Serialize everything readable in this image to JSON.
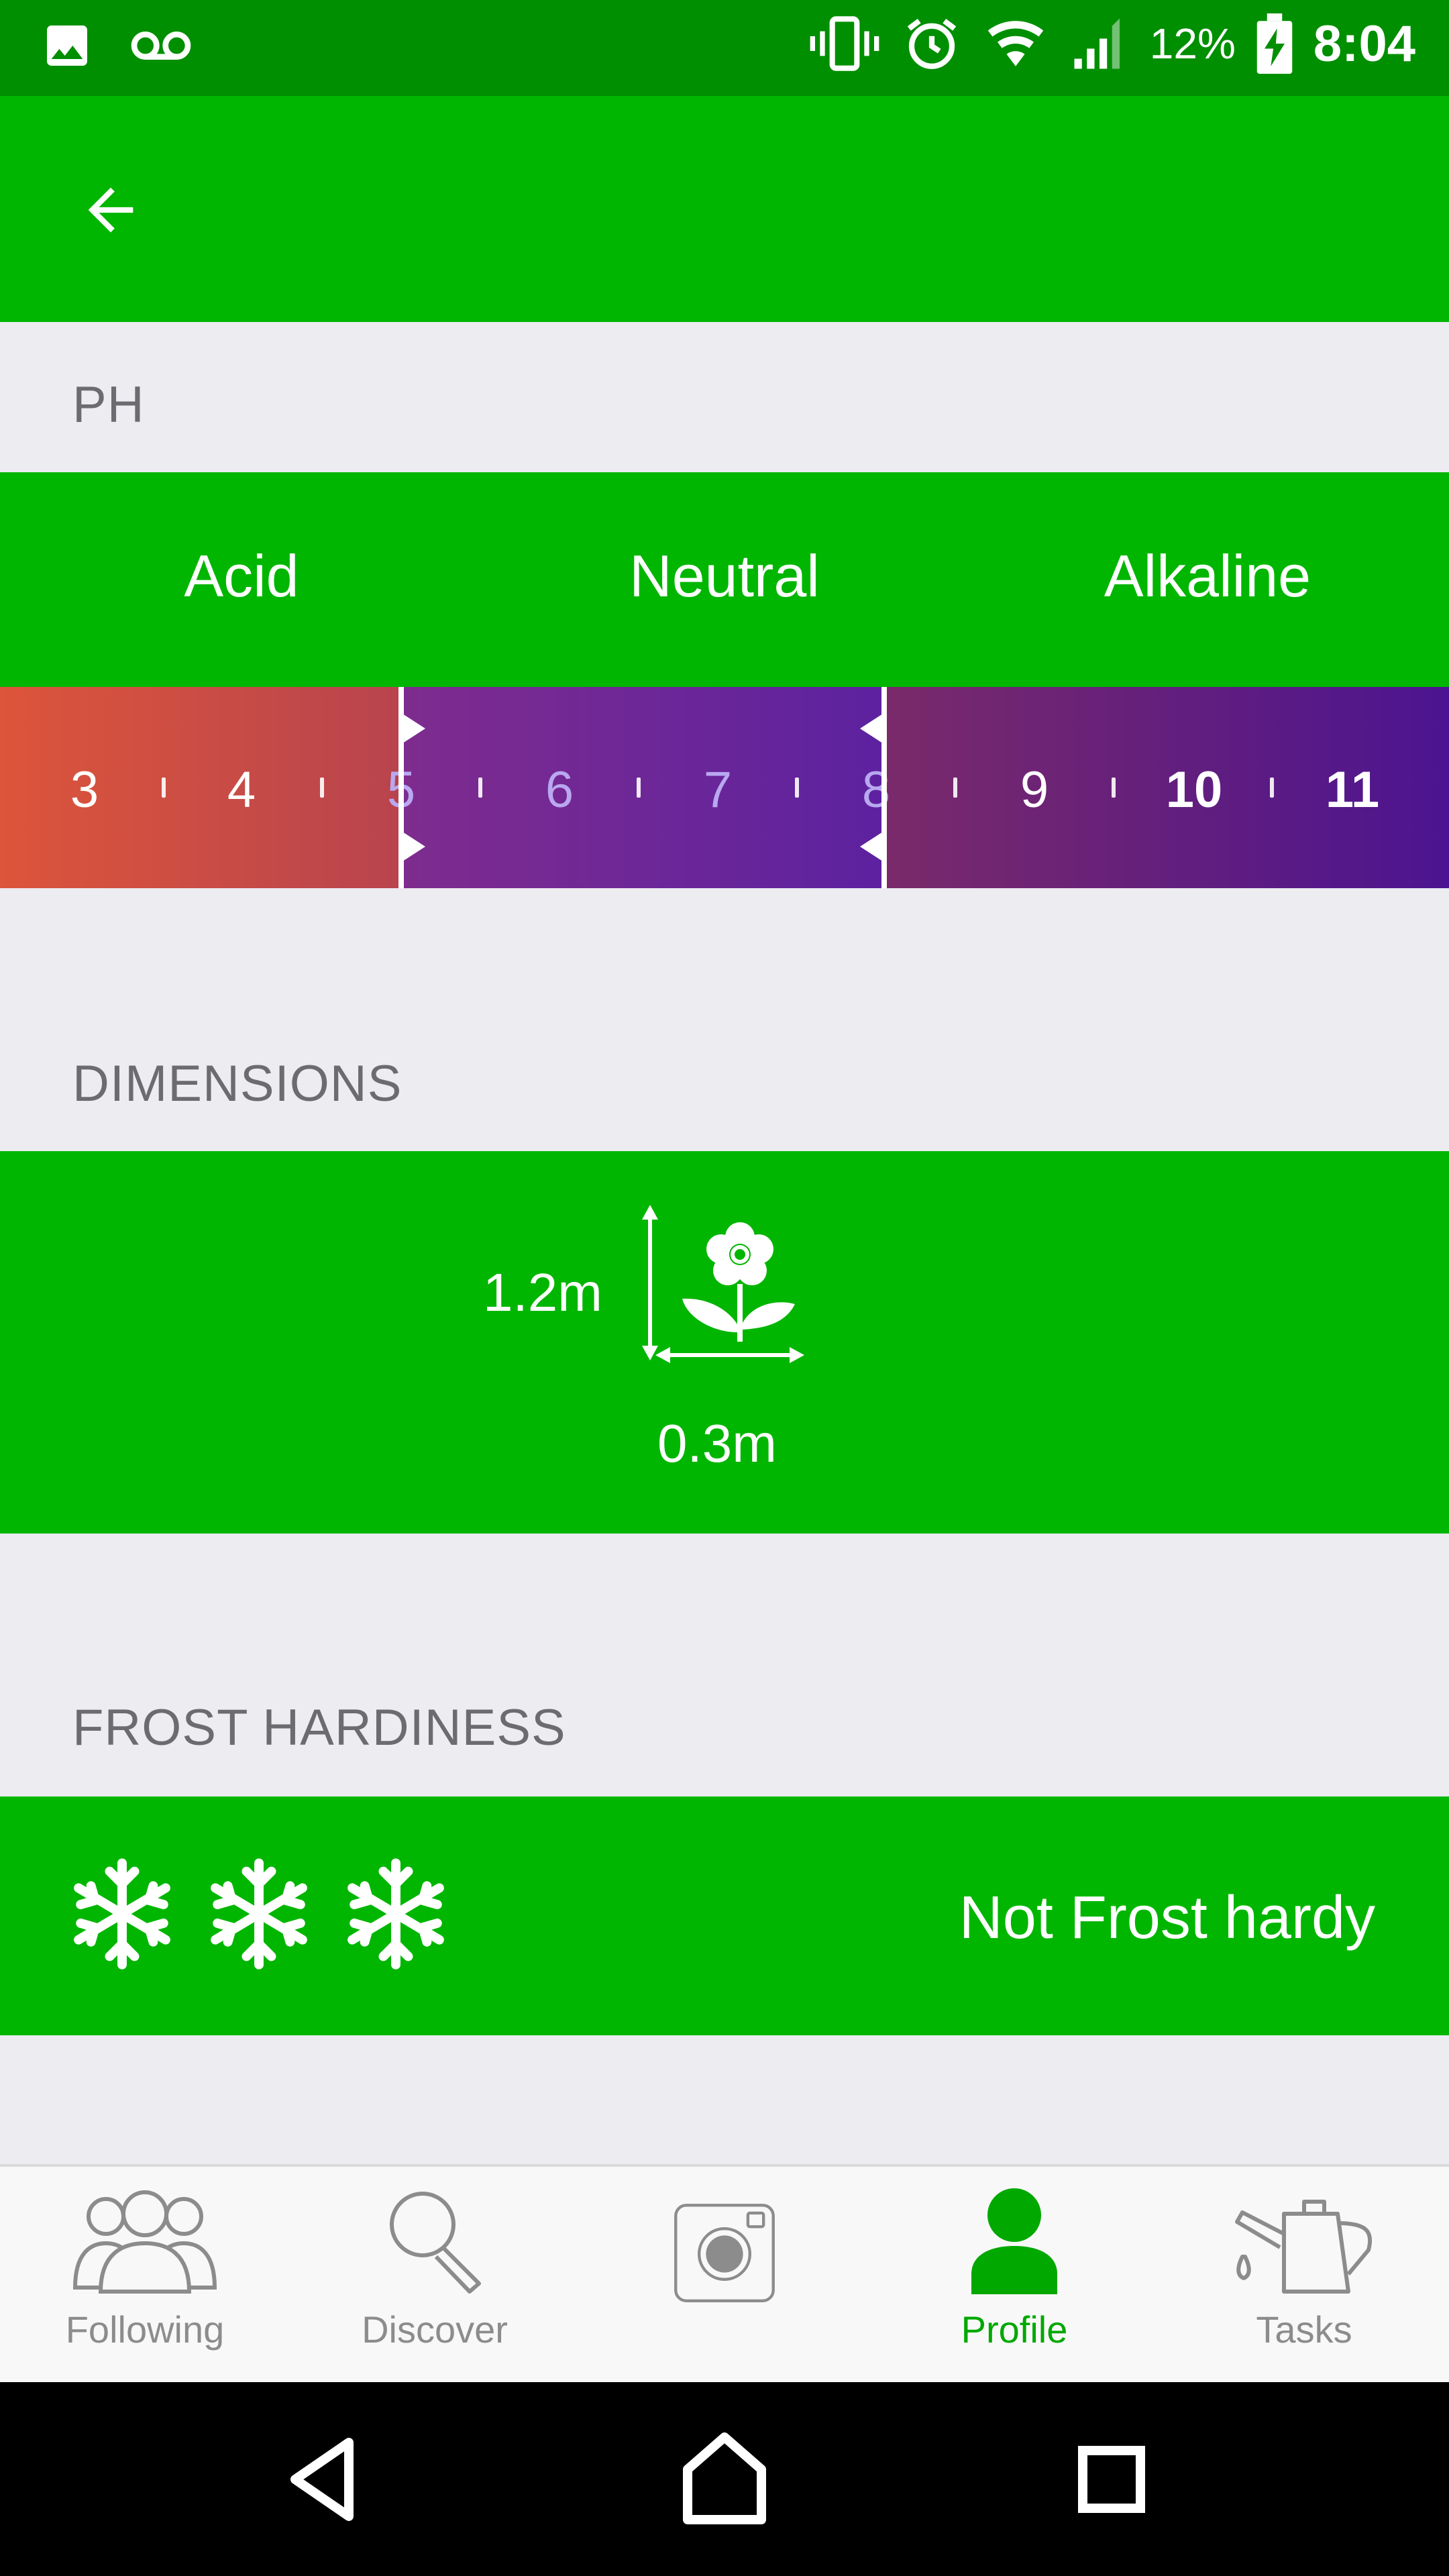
{
  "status_bar": {
    "battery": "12%",
    "time": "8:04",
    "icons": [
      "image-icon",
      "voicemail-icon",
      "vibrate-icon",
      "alarm-icon",
      "wifi-icon",
      "signal-icon",
      "battery-charging-icon"
    ]
  },
  "app_bar": {
    "back_icon": "arrow-left-icon"
  },
  "ph": {
    "header": "PH",
    "labels": [
      "Acid",
      "Neutral",
      "Alkaline"
    ],
    "scale": [
      "3",
      "4",
      "5",
      "6",
      "7",
      "8",
      "9",
      "10",
      "11"
    ],
    "range": {
      "min": 5,
      "max": 8
    },
    "colors": {
      "acid": "#DD553A",
      "neutral": "#6A25A0",
      "alkaline": "#4C1490"
    }
  },
  "dimensions": {
    "header": "DIMENSIONS",
    "height": "1.2m",
    "width": "0.3m",
    "icon": "flower-icon"
  },
  "frost": {
    "header": "FROST HARDINESS",
    "snowflakes": 3,
    "text": "Not Frost hardy",
    "icon": "snowflake-icon"
  },
  "bottom_nav": {
    "items": [
      {
        "label": "Following",
        "icon": "people-icon",
        "active": false
      },
      {
        "label": "Discover",
        "icon": "search-icon",
        "active": false
      },
      {
        "label": "",
        "icon": "camera-icon",
        "active": false
      },
      {
        "label": "Profile",
        "icon": "person-icon",
        "active": true
      },
      {
        "label": "Tasks",
        "icon": "watering-can-icon",
        "active": false
      }
    ]
  },
  "colors": {
    "primary": "#00B600",
    "status_bar": "#008F00",
    "background": "#ECECF1",
    "active_tab": "#00A800"
  }
}
